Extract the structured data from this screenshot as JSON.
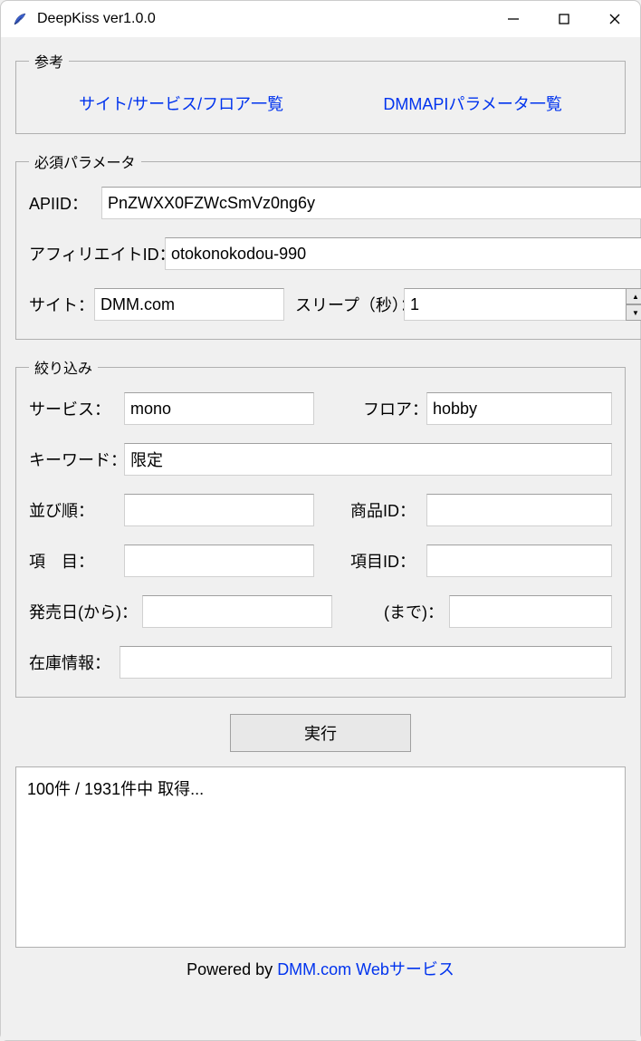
{
  "window": {
    "title": "DeepKiss ver1.0.0"
  },
  "reference": {
    "legend": "参考",
    "link_sites": "サイト/サービス/フロア一覧",
    "link_params": "DMMAPIパラメータ一覧"
  },
  "required": {
    "legend": "必須パラメータ",
    "api_id_label": "APIID：",
    "api_id_value": "PnZWXX0FZWcSmVz0ng6y",
    "affiliate_id_label": "アフィリエイトID：",
    "affiliate_id_value": "otokonokodou-990",
    "site_label": "サイト：",
    "site_value": "DMM.com",
    "sleep_label": "スリープ（秒）：",
    "sleep_value": "1"
  },
  "filter": {
    "legend": "絞り込み",
    "service_label": "サービス：",
    "service_value": "mono",
    "floor_label": "フロア：",
    "floor_value": "hobby",
    "keyword_label": "キーワード：",
    "keyword_value": "限定",
    "sort_label": "並び順：",
    "sort_value": "",
    "product_id_label": "商品ID：",
    "product_id_value": "",
    "item_label": "項　目：",
    "item_value": "",
    "item_id_label": "項目ID：",
    "item_id_value": "",
    "date_from_label": "発売日(から)：",
    "date_from_value": "",
    "date_to_label": "(まで)：",
    "date_to_value": "",
    "stock_label": "在庫情報：",
    "stock_value": ""
  },
  "actions": {
    "run_label": "実行"
  },
  "log": {
    "text": "100件 / 1931件中 取得..."
  },
  "footer": {
    "prefix": "Powered by ",
    "link": "DMM.com Webサービス"
  }
}
